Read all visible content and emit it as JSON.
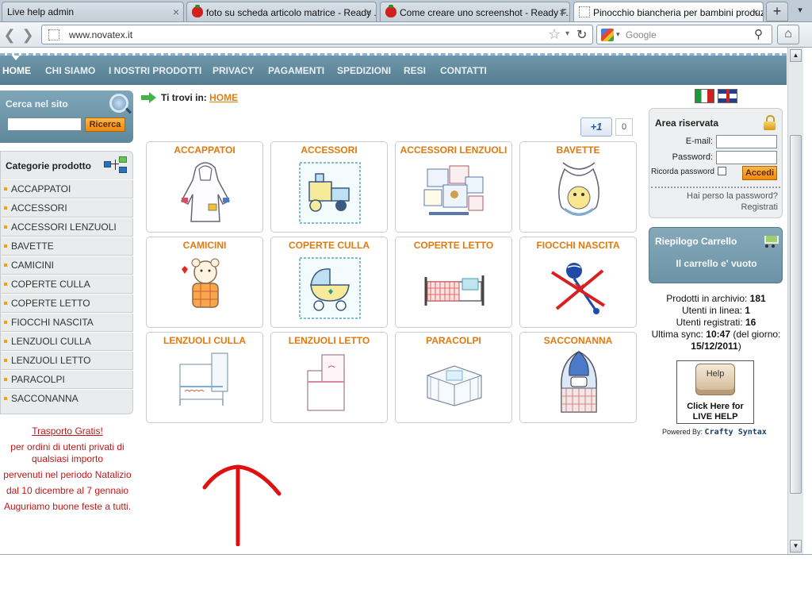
{
  "browser": {
    "tabs": [
      {
        "title": "Live help admin",
        "icon": "page-icon",
        "active": false
      },
      {
        "title": "foto su scheda articolo matrice - Ready ...",
        "icon": "strawberry-icon",
        "active": false
      },
      {
        "title": "Come creare uno screenshot - Ready F...",
        "icon": "strawberry-icon",
        "active": false
      },
      {
        "title": "Pinocchio biancheria per bambini produzi...",
        "icon": "page-icon",
        "active": true
      }
    ],
    "new_tab_label": "+",
    "url": "www.novatex.it",
    "search_placeholder": "Google"
  },
  "site": {
    "nav": [
      "HOME",
      "CHI SIAMO",
      "I NOSTRI PRODOTTI",
      "PRIVACY",
      "PAGAMENTI",
      "SPEDIZIONI",
      "RESI",
      "CONTATTI"
    ],
    "search_box": {
      "title": "Cerca nel sito",
      "button": "Ricerca",
      "value": ""
    },
    "categories": {
      "title": "Categorie prodotto",
      "items": [
        "ACCAPPATOI",
        "ACCESSORI",
        "ACCESSORI LENZUOLI",
        "BAVETTE",
        "CAMICINI",
        "COPERTE CULLA",
        "COPERTE LETTO",
        "FIOCCHI NASCITA",
        "LENZUOLI CULLA",
        "LENZUOLI LETTO",
        "PARACOLPI",
        "SACCONANNA"
      ]
    },
    "promo": {
      "link": "Trasporto Gratis!",
      "line1": "per ordini di utenti privati di qualsiasi importo",
      "line2": "pervenuti nel periodo Natalizio",
      "line3": "dal 10 dicembre al 7 gennaio",
      "line4": "Auguriamo buone feste a tutti."
    },
    "breadcrumb": {
      "prefix": "Ti trovi in:",
      "current": "HOME"
    },
    "plusone": {
      "label": "+1",
      "count": "0"
    },
    "products": [
      "ACCAPPATOI",
      "ACCESSORI",
      "ACCESSORI LENZUOLI",
      "BAVETTE",
      "CAMICINI",
      "COPERTE CULLA",
      "COPERTE LETTO",
      "FIOCCHI NASCITA",
      "LENZUOLI CULLA",
      "LENZUOLI LETTO",
      "PARACOLPI",
      "SACCONANNA"
    ],
    "login": {
      "title": "Area riservata",
      "email_label": "E-mail:",
      "password_label": "Password:",
      "remember_label": "Ricorda password",
      "button": "Accedi",
      "forgot": "Hai perso la password?",
      "register": "Registrati"
    },
    "cart": {
      "title": "Riepilogo Carrello",
      "empty": "Il carrello e' vuoto"
    },
    "stats": {
      "archive_label": "Prodotti in archivio:",
      "archive_value": "181",
      "online_label": "Utenti in linea:",
      "online_value": "1",
      "registered_label": "Utenti registrati:",
      "registered_value": "16",
      "sync_label": "Ultima sync:",
      "sync_time": "10:47",
      "sync_mid": "(del giorno:",
      "sync_date": "15/12/2011",
      "sync_end": ")"
    },
    "livehelp": {
      "key": "Help",
      "line1": "Click Here for",
      "line2": "LIVE HELP",
      "powered_prefix": "Powered By:",
      "powered_brand": "Crafty Syntax"
    }
  },
  "colors": {
    "nav_bar": "#6e97a9",
    "accent_orange": "#e07a10",
    "promo_red": "#c01818",
    "annotation_red": "#e01010"
  }
}
